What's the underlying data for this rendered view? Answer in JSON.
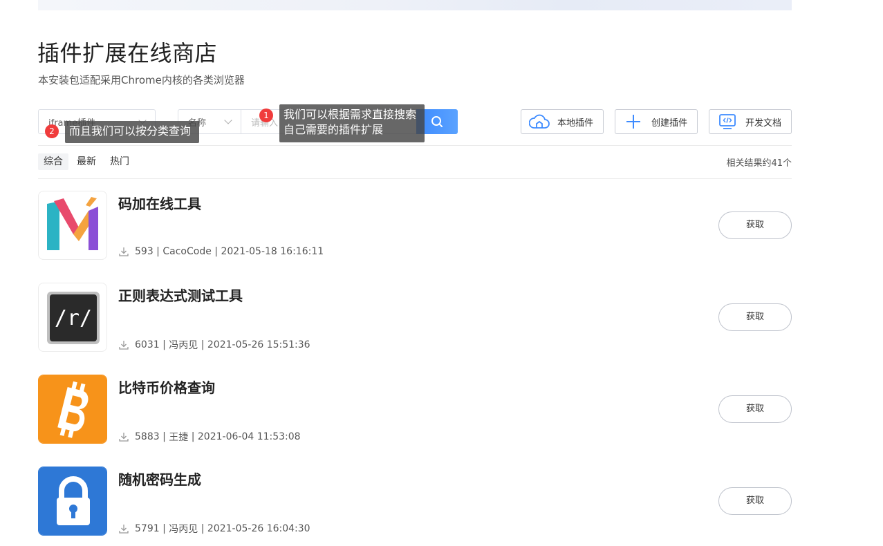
{
  "header": {
    "title": "插件扩展在线商店",
    "subtitle": "本安装包适配采用Chrome内核的各类浏览器"
  },
  "search": {
    "category_value": "iframe插件",
    "field_value": "名称",
    "placeholder": "请输入"
  },
  "tips": {
    "search_badge": "1",
    "search_text": "我们可以根据需求直接搜索自己需要的插件扩展",
    "category_badge": "2",
    "category_text": "而且我们可以按分类查询"
  },
  "toolbar": {
    "local_label": "本地插件",
    "create_label": "创建插件",
    "docs_label": "开发文档"
  },
  "tabs": [
    "综合",
    "最新",
    "热门"
  ],
  "result_count": "相关结果约41个",
  "items": [
    {
      "name": "码加在线工具",
      "downloads": "593",
      "author": "CacoCode",
      "date": "2021-05-18 16:16:11",
      "button": "获取"
    },
    {
      "name": "正则表达式测试工具",
      "downloads": "6031",
      "author": "冯丙见",
      "date": "2021-05-26 15:51:36",
      "button": "获取"
    },
    {
      "name": "比特币价格查询",
      "downloads": "5883",
      "author": "王捷",
      "date": "2021-06-04 11:53:08",
      "button": "获取"
    },
    {
      "name": "随机密码生成",
      "downloads": "5791",
      "author": "冯丙见",
      "date": "2021-05-26 16:04:30",
      "button": "获取"
    }
  ],
  "icons": {
    "search": "search-icon",
    "local": "cloud-home-icon",
    "create": "plus-icon",
    "docs": "code-doc-icon",
    "download": "download-icon"
  },
  "colors": {
    "accent": "#4a95ff",
    "badge": "#f03c3c",
    "tooltip": "#464646"
  }
}
